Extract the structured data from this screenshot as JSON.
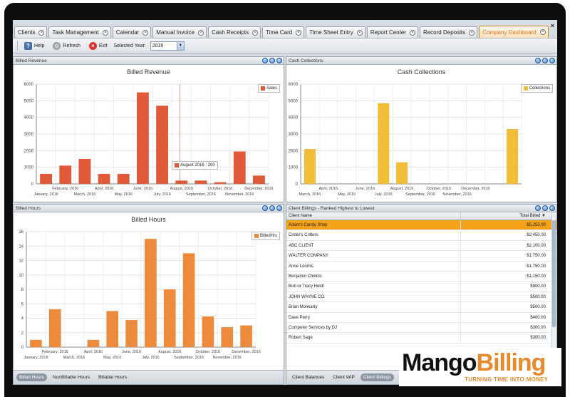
{
  "tabs": [
    {
      "label": "Clients"
    },
    {
      "label": "Task Management"
    },
    {
      "label": "Calendar"
    },
    {
      "label": "Manual Invoice"
    },
    {
      "label": "Cash Receipts"
    },
    {
      "label": "Time Card"
    },
    {
      "label": "Time Sheet Entry"
    },
    {
      "label": "Report Center"
    },
    {
      "label": "Record Deposits"
    },
    {
      "label": "Company Dashboard",
      "active": true
    }
  ],
  "window_close": "×",
  "toolbar": {
    "help_label": "Help",
    "refresh_label": "Refresh",
    "exit_label": "Exit",
    "year_label": "Selected Year:",
    "year_value": "2016"
  },
  "panels": {
    "billed_revenue": "Billed Revenue",
    "cash_collections": "Cash Collections",
    "billed_hours": "Billed Hours",
    "client_billings": "Client Billings - Ranked Highest to Lowest"
  },
  "tooltip": "August 2016 : 200",
  "chart_data": [
    {
      "type": "bar",
      "title": "Billed Revenue",
      "color": "#e05a3a",
      "series": [
        {
          "name": "Sales",
          "values": [
            600,
            1100,
            1500,
            600,
            600,
            5500,
            4700,
            200,
            200,
            100,
            1950,
            500
          ]
        }
      ],
      "categories": [
        "January, 2016",
        "February, 2016",
        "March, 2016",
        "April, 2016",
        "May, 2016",
        "June, 2016",
        "July, 2016",
        "August, 2016",
        "September, 2016",
        "October, 2016",
        "November, 2016",
        "December, 2016"
      ],
      "ylim": [
        0,
        6000
      ],
      "yticks": [
        0,
        1000,
        2000,
        3000,
        4000,
        5000,
        6000
      ],
      "grid": true,
      "legend": "top-right"
    },
    {
      "type": "bar",
      "title": "Cash Collections",
      "color": "#f2be3a",
      "series": [
        {
          "name": "Collections",
          "values": [
            2100,
            0,
            0,
            0,
            4850,
            1300,
            0,
            0,
            0,
            0,
            0,
            3300
          ]
        }
      ],
      "categories": [
        "March, 2016",
        "April, 2016",
        "May, 2016",
        "June, 2016",
        "July, 2016",
        "August, 2016",
        "September, 2016",
        "October, 2016",
        "November, 2016",
        "December, 2016",
        "",
        ""
      ],
      "tick_labels": [
        "March, 2016",
        "April, 2016",
        "May, 2016",
        "June, 2016",
        "July, 2016",
        "August, 2016",
        "September, 2016",
        "October, 2016",
        "November, 2016",
        "December, 2016"
      ],
      "ylim": [
        0,
        6000
      ],
      "yticks": [
        0,
        1000,
        2000,
        3000,
        4000,
        5000,
        6000
      ],
      "grid": true,
      "legend": "top-right"
    },
    {
      "type": "bar",
      "title": "Billed Hours",
      "color": "#ee8a3c",
      "series": [
        {
          "name": "BilledHrs",
          "values": [
            1,
            5.25,
            0,
            1,
            5,
            3.75,
            15,
            8,
            13,
            4.25,
            2.75,
            3
          ]
        }
      ],
      "categories": [
        "January, 2016",
        "February, 2016",
        "March, 2016",
        "April, 2016",
        "May, 2016",
        "June, 2016",
        "July, 2016",
        "August, 2016",
        "September, 2016",
        "October, 2016",
        "November, 2016",
        "December, 2016"
      ],
      "ylim": [
        0,
        16
      ],
      "yticks": [
        0,
        2,
        4,
        6,
        8,
        10,
        12,
        14,
        16
      ],
      "grid": true,
      "legend": "top-right"
    }
  ],
  "hours_tabs": [
    "Billed Hours",
    "NonBillable Hours",
    "Billable Hours"
  ],
  "grid": {
    "columns": [
      "Client Name",
      "Total Billed ▼"
    ],
    "rows": [
      {
        "name": "Adam's Candy Shop",
        "amount": "$5,253.00"
      },
      {
        "name": "Crider's Critters",
        "amount": "$2,450.00"
      },
      {
        "name": "ABC CLIENT",
        "amount": "$2,100.00"
      },
      {
        "name": "WALTER COMPANY",
        "amount": "$1,750.00"
      },
      {
        "name": "Anne Loomis",
        "amount": "$1,750.00"
      },
      {
        "name": "Benjamin Chelois",
        "amount": "$1,150.00"
      },
      {
        "name": "Bob or Tracy Heldt",
        "amount": "$900.00"
      },
      {
        "name": "JOHN WAYNE CO.",
        "amount": "$500.00"
      },
      {
        "name": "Brian Monkarty",
        "amount": "$500.00"
      },
      {
        "name": "Dave Perry",
        "amount": "$400.00"
      },
      {
        "name": "Computer Services by DJ",
        "amount": "$300.00"
      },
      {
        "name": "Robert Sage",
        "amount": "$300.00"
      }
    ]
  },
  "billing_tabs": [
    "Client Balances",
    "Client WIP",
    "Client Billings"
  ],
  "logo": {
    "mango": "Mango",
    "billing": "Billing",
    "tagline": "TURNING TIME INTO MONEY"
  }
}
